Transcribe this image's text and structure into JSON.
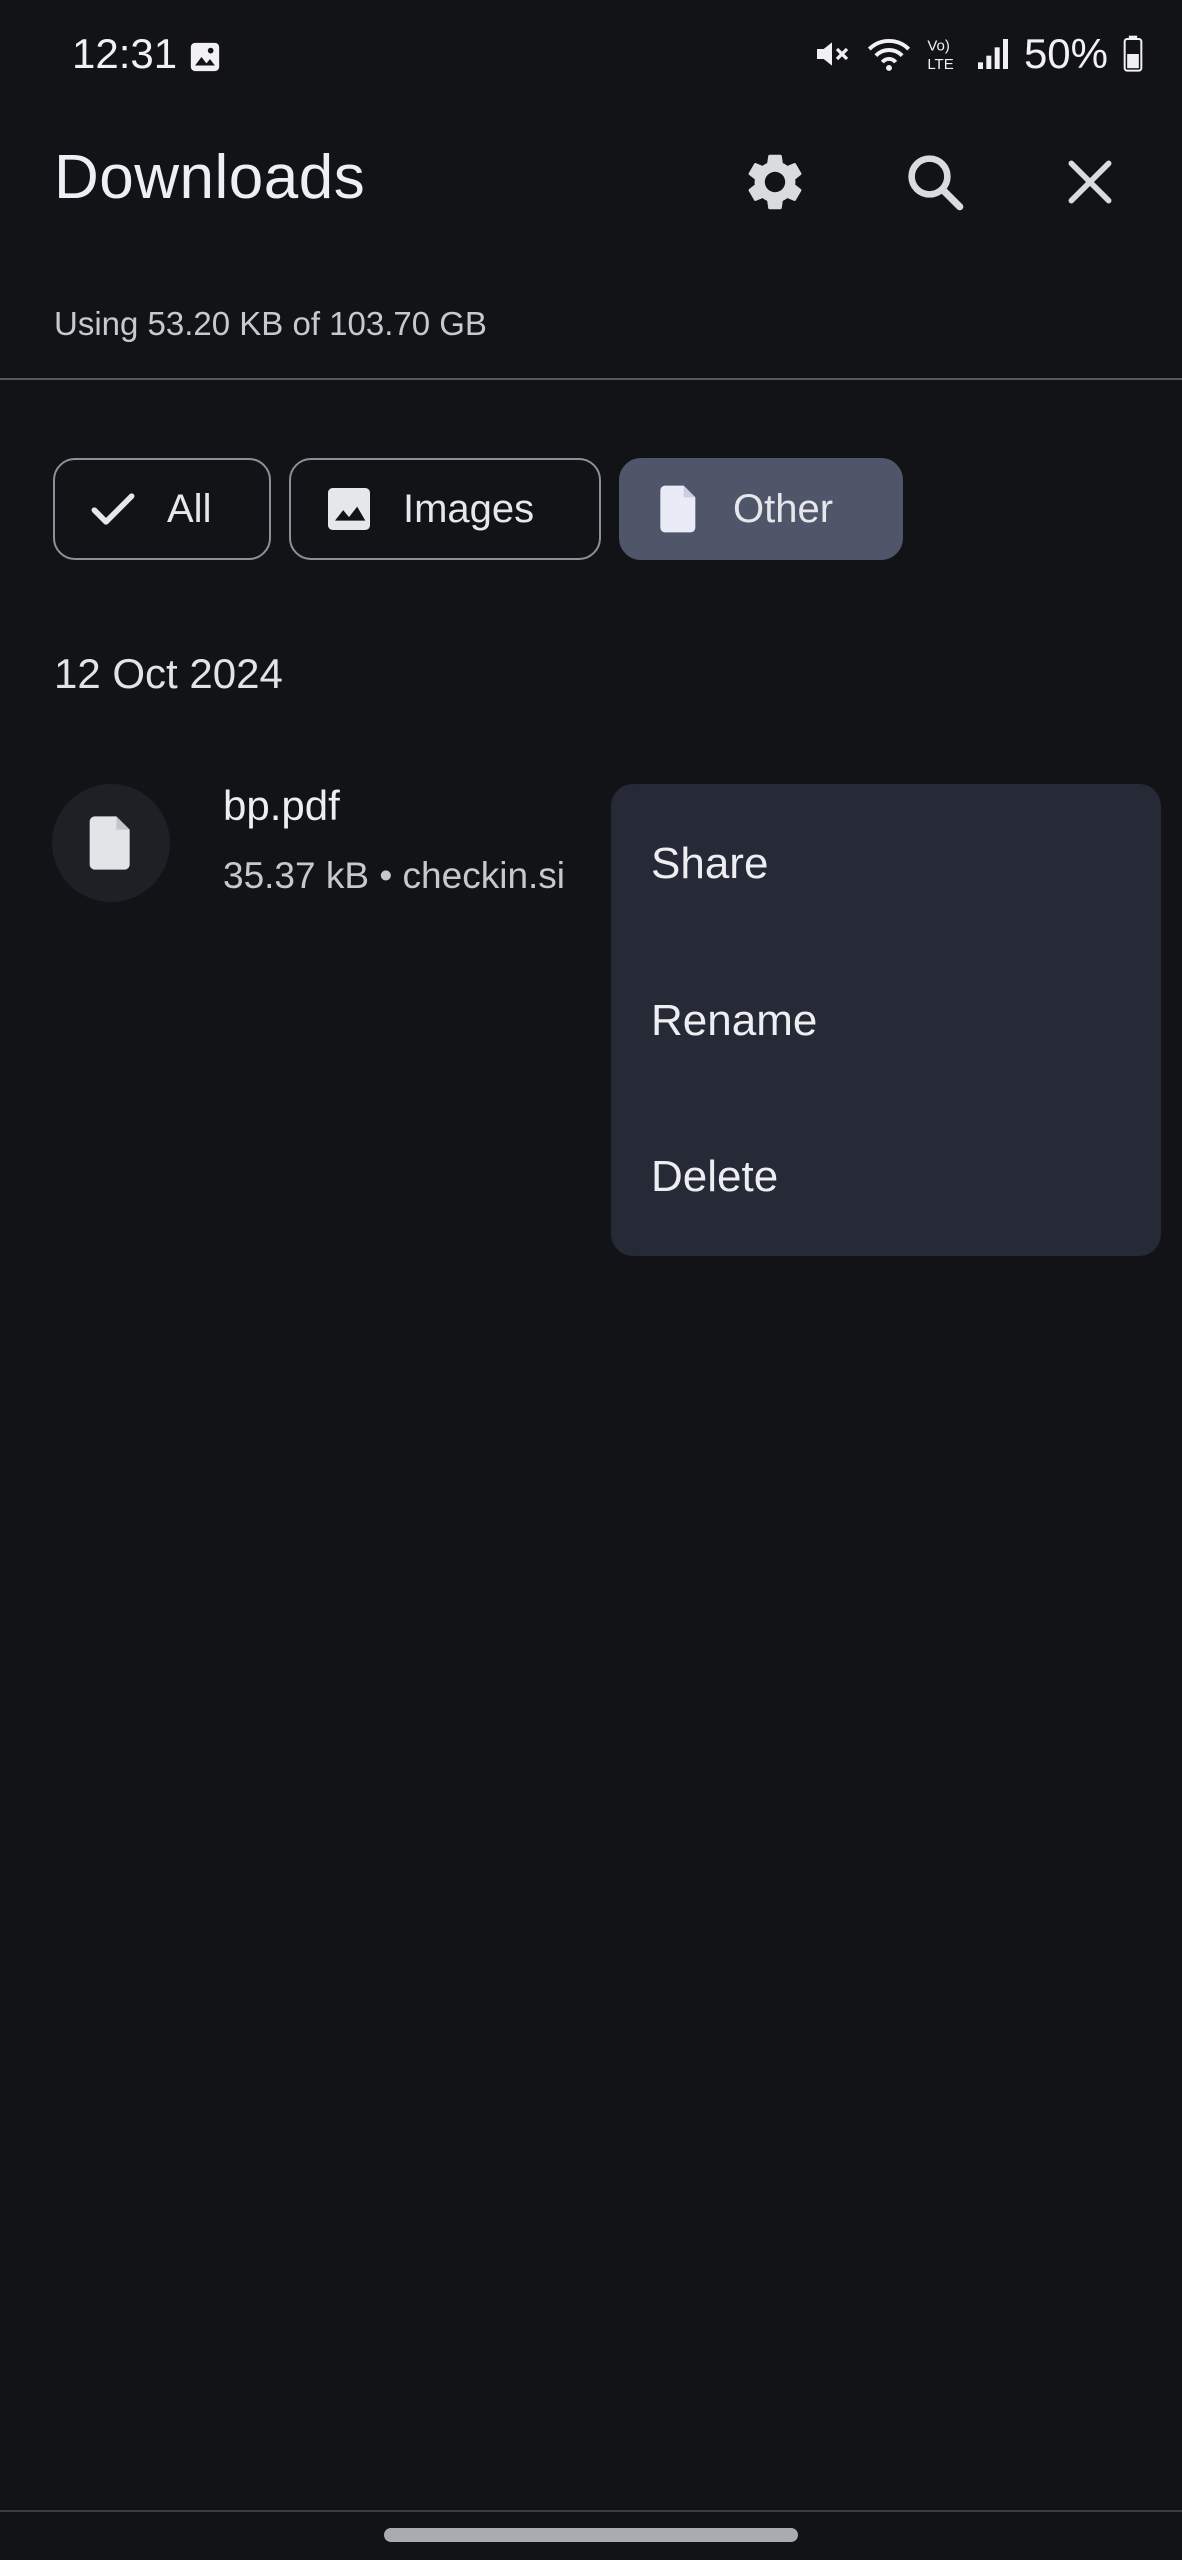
{
  "status_bar": {
    "time": "12:31",
    "battery": "50%",
    "icons": [
      "gallery-icon",
      "mute-icon",
      "wifi-icon",
      "volte-icon",
      "signal-icon",
      "battery-icon"
    ]
  },
  "app_bar": {
    "title": "Downloads",
    "actions": [
      "settings-icon",
      "search-icon",
      "close-icon"
    ]
  },
  "storage": {
    "usage_text": "Using 53.20 KB of 103.70 GB"
  },
  "filters": {
    "chips": [
      {
        "label": "All",
        "icon": "check-icon",
        "selected": false
      },
      {
        "label": "Images",
        "icon": "image-icon",
        "selected": false
      },
      {
        "label": "Other",
        "icon": "file-icon",
        "selected": true
      }
    ]
  },
  "list": {
    "date_header": "12 Oct 2024",
    "items": [
      {
        "name": "bp.pdf",
        "meta": "35.37 kB • checkin.si"
      }
    ]
  },
  "context_menu": {
    "items": [
      "Share",
      "Rename",
      "Delete"
    ]
  },
  "colors": {
    "background": "#121317",
    "chip_selected": "#4f566a",
    "menu_background": "#262a36"
  }
}
